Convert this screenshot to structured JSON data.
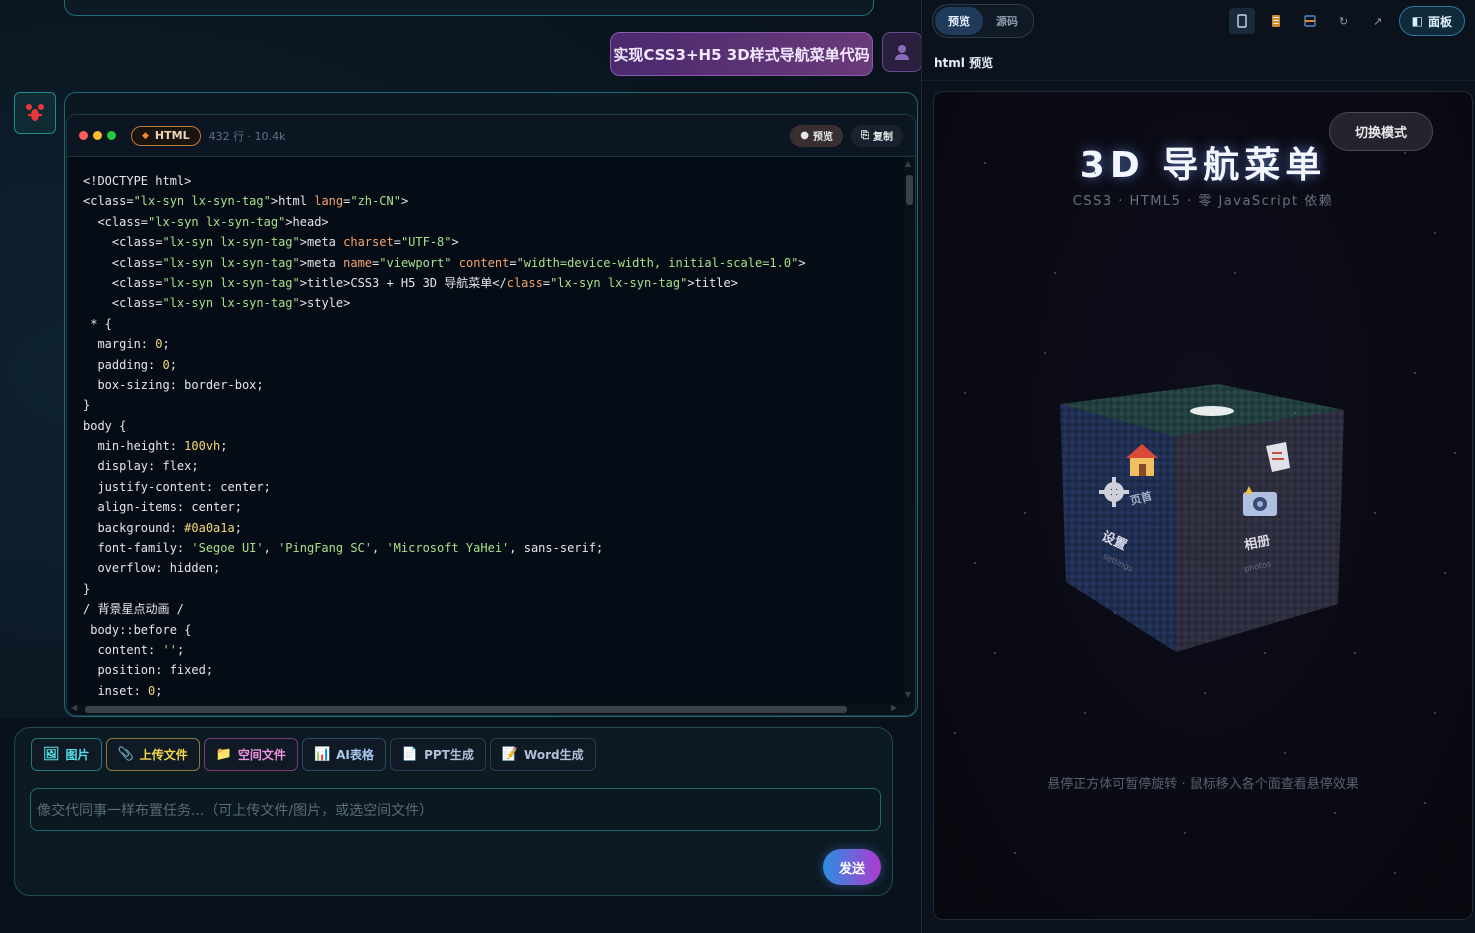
{
  "chat": {
    "user_message": "实现CSS3+H5 3D样式导航菜单代码"
  },
  "code_block": {
    "language": "HTML",
    "meta": "432 行 · 10.4k",
    "preview_label": "预览",
    "copy_label": "复制",
    "lines": [
      [
        [
          "c-punc",
          "<!DOCTYPE html>"
        ]
      ],
      [
        [
          "c-punc",
          "<class="
        ],
        [
          "c-str",
          "\"lx-syn lx-syn-tag\""
        ],
        [
          "c-punc",
          ">html "
        ],
        [
          "c-attr",
          "lang"
        ],
        [
          "c-punc",
          "="
        ],
        [
          "c-str",
          "\"zh-CN\""
        ],
        [
          "c-punc",
          ">"
        ]
      ],
      [
        [
          "c-punc",
          "  <class="
        ],
        [
          "c-str",
          "\"lx-syn lx-syn-tag\""
        ],
        [
          "c-punc",
          ">head>"
        ]
      ],
      [
        [
          "c-punc",
          "    <class="
        ],
        [
          "c-str",
          "\"lx-syn lx-syn-tag\""
        ],
        [
          "c-punc",
          ">meta "
        ],
        [
          "c-attr",
          "charset"
        ],
        [
          "c-punc",
          "="
        ],
        [
          "c-str",
          "\"UTF-8\""
        ],
        [
          "c-punc",
          ">"
        ]
      ],
      [
        [
          "c-punc",
          "    <class="
        ],
        [
          "c-str",
          "\"lx-syn lx-syn-tag\""
        ],
        [
          "c-punc",
          ">meta "
        ],
        [
          "c-attr",
          "name"
        ],
        [
          "c-punc",
          "="
        ],
        [
          "c-str",
          "\"viewport\""
        ],
        [
          "c-punc",
          " "
        ],
        [
          "c-attr",
          "content"
        ],
        [
          "c-punc",
          "="
        ],
        [
          "c-str",
          "\"width=device-width, initial-scale=1.0\""
        ],
        [
          "c-punc",
          ">"
        ]
      ],
      [
        [
          "c-punc",
          "    <class="
        ],
        [
          "c-str",
          "\"lx-syn lx-syn-tag\""
        ],
        [
          "c-punc",
          ">title>CSS3 + H5 3D 导航菜单</"
        ],
        [
          "c-attr",
          "class"
        ],
        [
          "c-punc",
          "="
        ],
        [
          "c-str",
          "\"lx-syn lx-syn-tag\""
        ],
        [
          "c-punc",
          ">title>"
        ]
      ],
      [
        [
          "c-punc",
          "    <class="
        ],
        [
          "c-str",
          "\"lx-syn lx-syn-tag\""
        ],
        [
          "c-punc",
          ">style>"
        ]
      ],
      [
        [
          "c-punc",
          " * {"
        ]
      ],
      [
        [
          "c-key",
          "  margin"
        ],
        [
          "c-punc",
          ": "
        ],
        [
          "c-num",
          "0"
        ],
        [
          "c-punc",
          ";"
        ]
      ],
      [
        [
          "c-key",
          "  padding"
        ],
        [
          "c-punc",
          ": "
        ],
        [
          "c-num",
          "0"
        ],
        [
          "c-punc",
          ";"
        ]
      ],
      [
        [
          "c-key",
          "  box-sizing"
        ],
        [
          "c-punc",
          ": border-box;"
        ]
      ],
      [
        [
          "c-punc",
          "}"
        ]
      ],
      [
        [
          "c-punc",
          "body {"
        ]
      ],
      [
        [
          "c-key",
          "  min-height"
        ],
        [
          "c-punc",
          ": "
        ],
        [
          "c-num",
          "100vh"
        ],
        [
          "c-punc",
          ";"
        ]
      ],
      [
        [
          "c-key",
          "  display"
        ],
        [
          "c-punc",
          ": flex;"
        ]
      ],
      [
        [
          "c-key",
          "  justify-content"
        ],
        [
          "c-punc",
          ": center;"
        ]
      ],
      [
        [
          "c-key",
          "  align-items"
        ],
        [
          "c-punc",
          ": center;"
        ]
      ],
      [
        [
          "c-key",
          "  background"
        ],
        [
          "c-punc",
          ": "
        ],
        [
          "c-num",
          "#0a0a1a"
        ],
        [
          "c-punc",
          ";"
        ]
      ],
      [
        [
          "c-key",
          "  font-family"
        ],
        [
          "c-punc",
          ": "
        ],
        [
          "c-str",
          "'Segoe UI'"
        ],
        [
          "c-punc",
          ", "
        ],
        [
          "c-str",
          "'PingFang SC'"
        ],
        [
          "c-punc",
          ", "
        ],
        [
          "c-str",
          "'Microsoft YaHei'"
        ],
        [
          "c-punc",
          ", sans-serif;"
        ]
      ],
      [
        [
          "c-key",
          "  overflow"
        ],
        [
          "c-punc",
          ": hidden;"
        ]
      ],
      [
        [
          "c-punc",
          "}"
        ]
      ],
      [
        [
          "c-punc",
          "/ 背景星点动画 /"
        ]
      ],
      [
        [
          "c-punc",
          " body::before {"
        ]
      ],
      [
        [
          "c-key",
          "  content"
        ],
        [
          "c-punc",
          ": "
        ],
        [
          "c-str",
          "''"
        ],
        [
          "c-punc",
          ";"
        ]
      ],
      [
        [
          "c-key",
          "  position"
        ],
        [
          "c-punc",
          ": fixed;"
        ]
      ],
      [
        [
          "c-key",
          "  inset"
        ],
        [
          "c-punc",
          ": "
        ],
        [
          "c-num",
          "0"
        ],
        [
          "c-punc",
          ";"
        ]
      ]
    ]
  },
  "composer": {
    "tools": [
      {
        "label": "图片",
        "icon": "image-icon",
        "glyph": "🖼"
      },
      {
        "label": "上传文件",
        "icon": "paperclip-icon",
        "glyph": "📎"
      },
      {
        "label": "空间文件",
        "icon": "folder-icon",
        "glyph": "📁"
      },
      {
        "label": "AI表格",
        "icon": "chart-icon",
        "glyph": "📊"
      },
      {
        "label": "PPT生成",
        "icon": "document-icon",
        "glyph": "📄"
      },
      {
        "label": "Word生成",
        "icon": "document-edit-icon",
        "glyph": "📝"
      }
    ],
    "placeholder": "像交代同事一样布置任务...（可上传文件/图片，或选空间文件）",
    "send_label": "发送"
  },
  "right_panel": {
    "tabs": [
      {
        "label": "预览",
        "active": true
      },
      {
        "label": "源码",
        "active": false
      }
    ],
    "panel_button": "面板",
    "panel_label": "html 预览",
    "preview": {
      "switch_mode": "切换模式",
      "title": "3D 导航菜单",
      "subtitle": "CSS3 · HTML5 · 零 JavaScript 依赖",
      "hint": "悬停正方体可暂停旋转 · 鼠标移入各个面查看悬停效果",
      "faces": [
        {
          "label": "页首"
        },
        {
          "label": "设置",
          "sub": "settings"
        },
        {
          "label": "相册",
          "sub": "photos"
        }
      ]
    }
  },
  "colors": {
    "accent_teal": "#1f8a90",
    "send_gradient_start": "#2a8ee0",
    "send_gradient_end": "#b03ad0"
  }
}
